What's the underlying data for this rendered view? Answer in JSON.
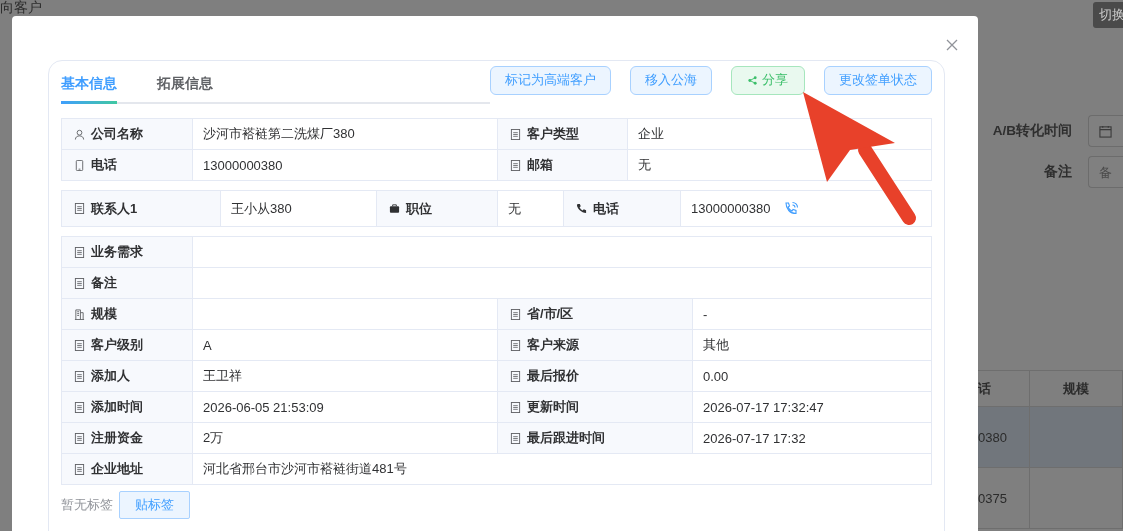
{
  "background": {
    "title": "向客户",
    "switch_button": "切换",
    "filters": [
      {
        "label": "A/B转化时间",
        "kind": "date"
      },
      {
        "label": "备注",
        "kind": "text",
        "placeholder": "备"
      }
    ],
    "table": {
      "columns": [
        "话",
        "规模"
      ],
      "rows": [
        {
          "phone": "0380",
          "selected": true
        },
        {
          "phone": "0375",
          "selected": false
        }
      ]
    }
  },
  "dialog": {
    "tabs": [
      {
        "label": "基本信息",
        "selected": true
      },
      {
        "label": "拓展信息",
        "selected": false
      }
    ],
    "actions": [
      {
        "label": "标记为高端客户",
        "kind": "default"
      },
      {
        "label": "移入公海",
        "kind": "default"
      },
      {
        "label": "分享",
        "kind": "share"
      },
      {
        "label": "更改签单状态",
        "kind": "default"
      }
    ],
    "company_rows": [
      [
        {
          "label": "公司名称",
          "kind": "person",
          "value": "沙河市褡裢第二洗煤厂380"
        },
        {
          "label": "客户类型",
          "kind": "doc",
          "value": "企业"
        }
      ],
      [
        {
          "label": "电话",
          "kind": "mobile",
          "value": "13000000380"
        },
        {
          "label": "邮箱",
          "kind": "doc",
          "value": "无"
        }
      ]
    ],
    "contacts": [
      {
        "label": "联系人1",
        "kind": "doc",
        "value": "王小从380"
      },
      {
        "label": "职位",
        "kind": "briefcase",
        "value": "无"
      },
      {
        "label": "电话",
        "kind": "handset",
        "value": "13000000380",
        "callable": true
      }
    ],
    "detail_rows": [
      [
        {
          "label": "业务需求",
          "kind": "doc"
        }
      ],
      [
        {
          "label": "备注",
          "kind": "doc"
        }
      ],
      [
        {
          "label": "规模",
          "kind": "building"
        },
        {
          "label": "省/市/区",
          "kind": "doc",
          "value": "-"
        }
      ],
      [
        {
          "label": "客户级别",
          "kind": "doc",
          "value": "A"
        },
        {
          "label": "客户来源",
          "kind": "doc",
          "value": "其他"
        }
      ],
      [
        {
          "label": "添加人",
          "kind": "doc",
          "value": "王卫祥"
        },
        {
          "label": "最后报价",
          "kind": "doc",
          "value": "0.00"
        }
      ],
      [
        {
          "label": "添加时间",
          "kind": "doc",
          "value": "2026-06-05 21:53:09"
        },
        {
          "label": "更新时间",
          "kind": "doc",
          "value": "2026-07-17 17:32:47"
        }
      ],
      [
        {
          "label": "注册资金",
          "kind": "doc",
          "value": "2万"
        },
        {
          "label": "最后跟进时间",
          "kind": "doc",
          "value": "2026-07-17 17:32"
        }
      ],
      [
        {
          "label": "企业地址",
          "kind": "doc",
          "value": "河北省邢台市沙河市褡裢街道481号"
        }
      ]
    ],
    "tags": {
      "empty_text": "暂无标签",
      "button": "贴标签"
    }
  }
}
